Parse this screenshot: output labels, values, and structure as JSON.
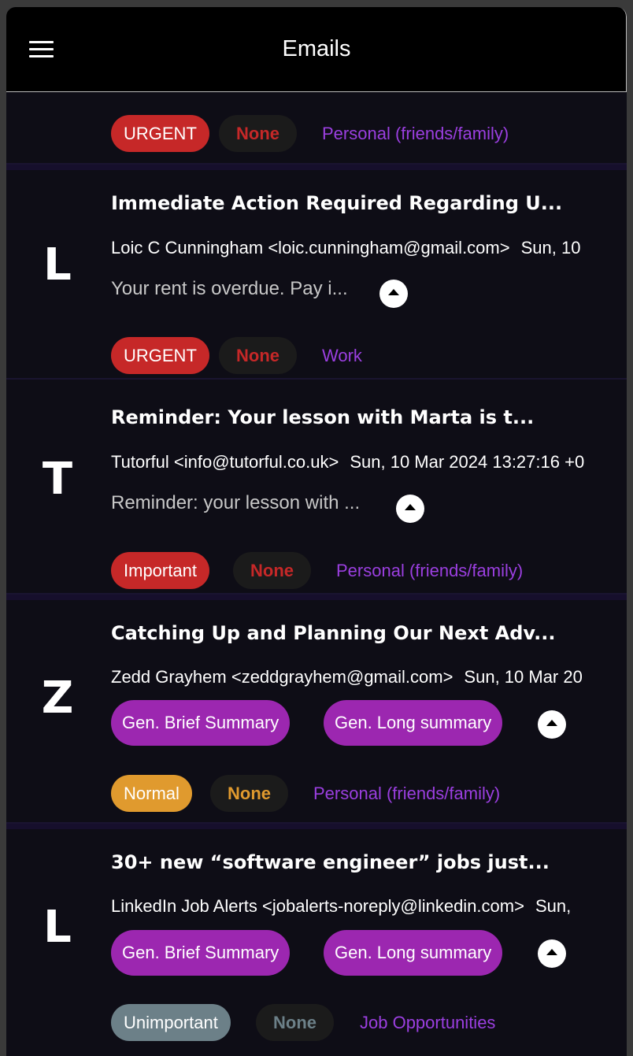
{
  "appbar": {
    "title": "Emails"
  },
  "colors": {
    "urgent": "#c62828",
    "important": "#c62828",
    "normal": "#e09a2e",
    "unimportant": "#6c8088",
    "category": "#9b3fe0",
    "gen_button": "#9c27b0"
  },
  "partial_card": {
    "priority": "URGENT",
    "tag": "None",
    "category": "Personal (friends/family)"
  },
  "emails": [
    {
      "avatar": "L",
      "subject": "Immediate Action Required Regarding U...",
      "sender": "Loic C Cunningham <loic.cunningham@gmail.com>",
      "date": "Sun, 10",
      "preview": "Your rent is overdue. Pay i...",
      "priority": "URGENT",
      "tag": "None",
      "category": "Work"
    },
    {
      "avatar": "T",
      "subject": "Reminder: Your lesson with Marta is t...",
      "sender": "Tutorful <info@tutorful.co.uk>",
      "date": "Sun, 10 Mar 2024 13:27:16 +0",
      "preview": "Reminder: your lesson with ...",
      "priority": "Important",
      "tag": "None",
      "category": "Personal (friends/family)"
    },
    {
      "avatar": "Z",
      "subject": "Catching Up and Planning Our Next Adv...",
      "sender": "Zedd Grayhem <zeddgrayhem@gmail.com>",
      "date": "Sun, 10 Mar 20",
      "brief_label": "Gen. Brief Summary",
      "long_label": "Gen. Long summary",
      "priority": "Normal",
      "tag": "None",
      "category": "Personal (friends/family)"
    },
    {
      "avatar": "L",
      "subject": "30+ new “software engineer” jobs just...",
      "sender": "LinkedIn Job Alerts <jobalerts-noreply@linkedin.com>",
      "date": "Sun,",
      "brief_label": "Gen. Brief Summary",
      "long_label": "Gen. Long summary",
      "priority": "Unimportant",
      "tag": "None",
      "category": "Job Opportunities"
    }
  ]
}
